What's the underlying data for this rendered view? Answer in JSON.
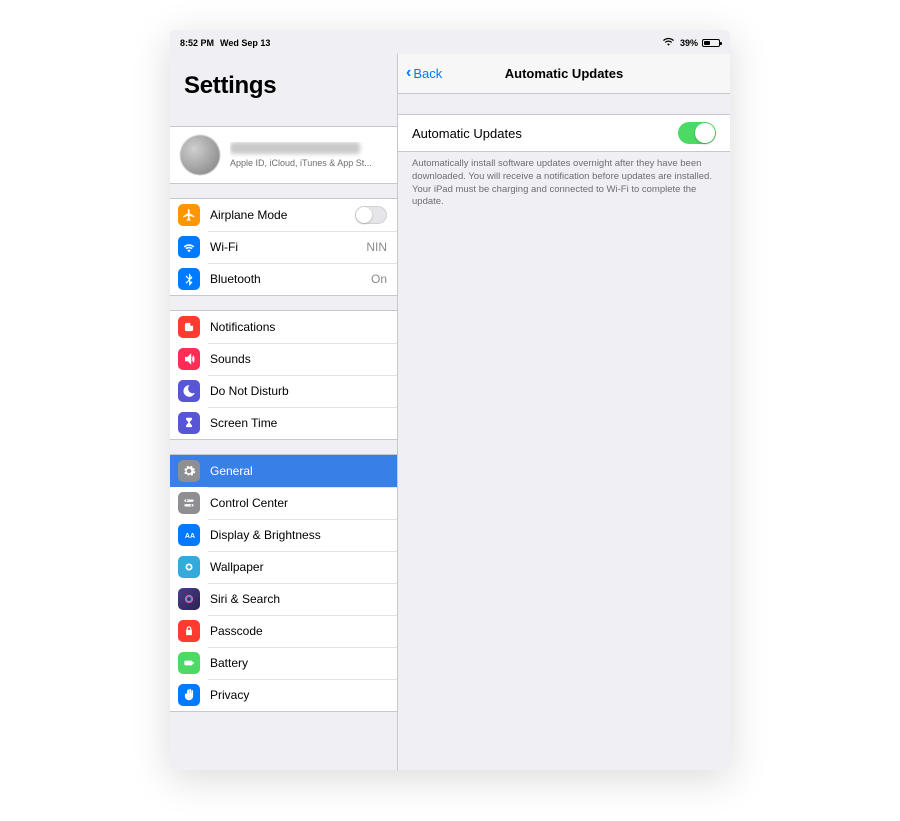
{
  "status": {
    "time": "8:52 PM",
    "date": "Wed Sep 13",
    "battery_pct": "39%"
  },
  "settings_title": "Settings",
  "account": {
    "subtext": "Apple ID, iCloud, iTunes & App St..."
  },
  "groups": {
    "connectivity": {
      "airplane": {
        "label": "Airplane Mode"
      },
      "wifi": {
        "label": "Wi-Fi",
        "value": "NIN"
      },
      "bluetooth": {
        "label": "Bluetooth",
        "value": "On"
      }
    },
    "alerts": {
      "notifications": {
        "label": "Notifications"
      },
      "sounds": {
        "label": "Sounds"
      },
      "dnd": {
        "label": "Do Not Disturb"
      },
      "screentime": {
        "label": "Screen Time"
      }
    },
    "general_group": {
      "general": {
        "label": "General"
      },
      "control_center": {
        "label": "Control Center"
      },
      "display": {
        "label": "Display & Brightness"
      },
      "wallpaper": {
        "label": "Wallpaper"
      },
      "siri": {
        "label": "Siri & Search"
      },
      "passcode": {
        "label": "Passcode"
      },
      "battery": {
        "label": "Battery"
      },
      "privacy": {
        "label": "Privacy"
      }
    }
  },
  "detail": {
    "back_label": "Back",
    "title": "Automatic Updates",
    "toggle_label": "Automatic Updates",
    "footer": "Automatically install software updates overnight after they have been downloaded. You will receive a notification before updates are installed. Your iPad must be charging and connected to Wi-Fi to complete the update."
  },
  "colors": {
    "accent": "#007aff",
    "selected": "#3880e8",
    "switch_green": "#4cd964"
  }
}
